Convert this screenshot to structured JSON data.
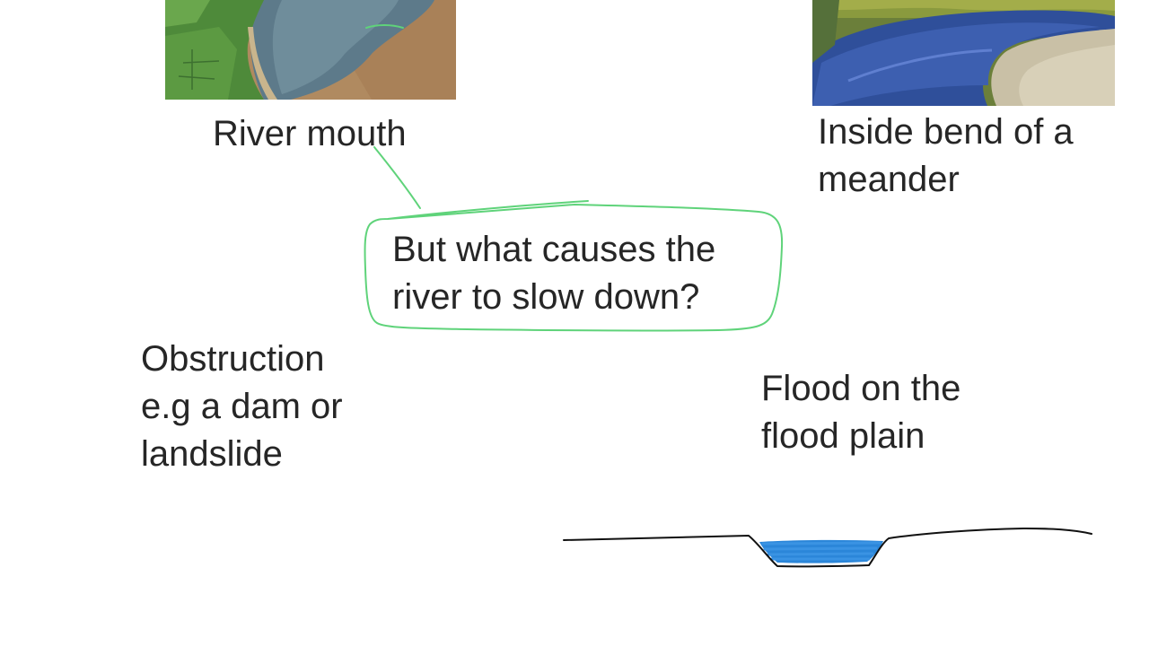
{
  "images": {
    "river_mouth_photo": "river-mouth-aerial-photo",
    "meander_photo": "meander-inside-bend-photo"
  },
  "captions": {
    "river_mouth": "River mouth",
    "meander_line1": "Inside bend of a",
    "meander_line2": "meander"
  },
  "question": {
    "line1": "But what causes the",
    "line2": "river to slow down?"
  },
  "obstruction": {
    "line1": "Obstruction",
    "line2": "e.g a dam or",
    "line3": "landslide"
  },
  "flood": {
    "line1": "Flood on the",
    "line2": "flood plain"
  },
  "colors": {
    "annotation_green": "#5fd37a",
    "water_blue": "#2b86d9",
    "text": "#262626",
    "sketch_line": "#111111"
  }
}
